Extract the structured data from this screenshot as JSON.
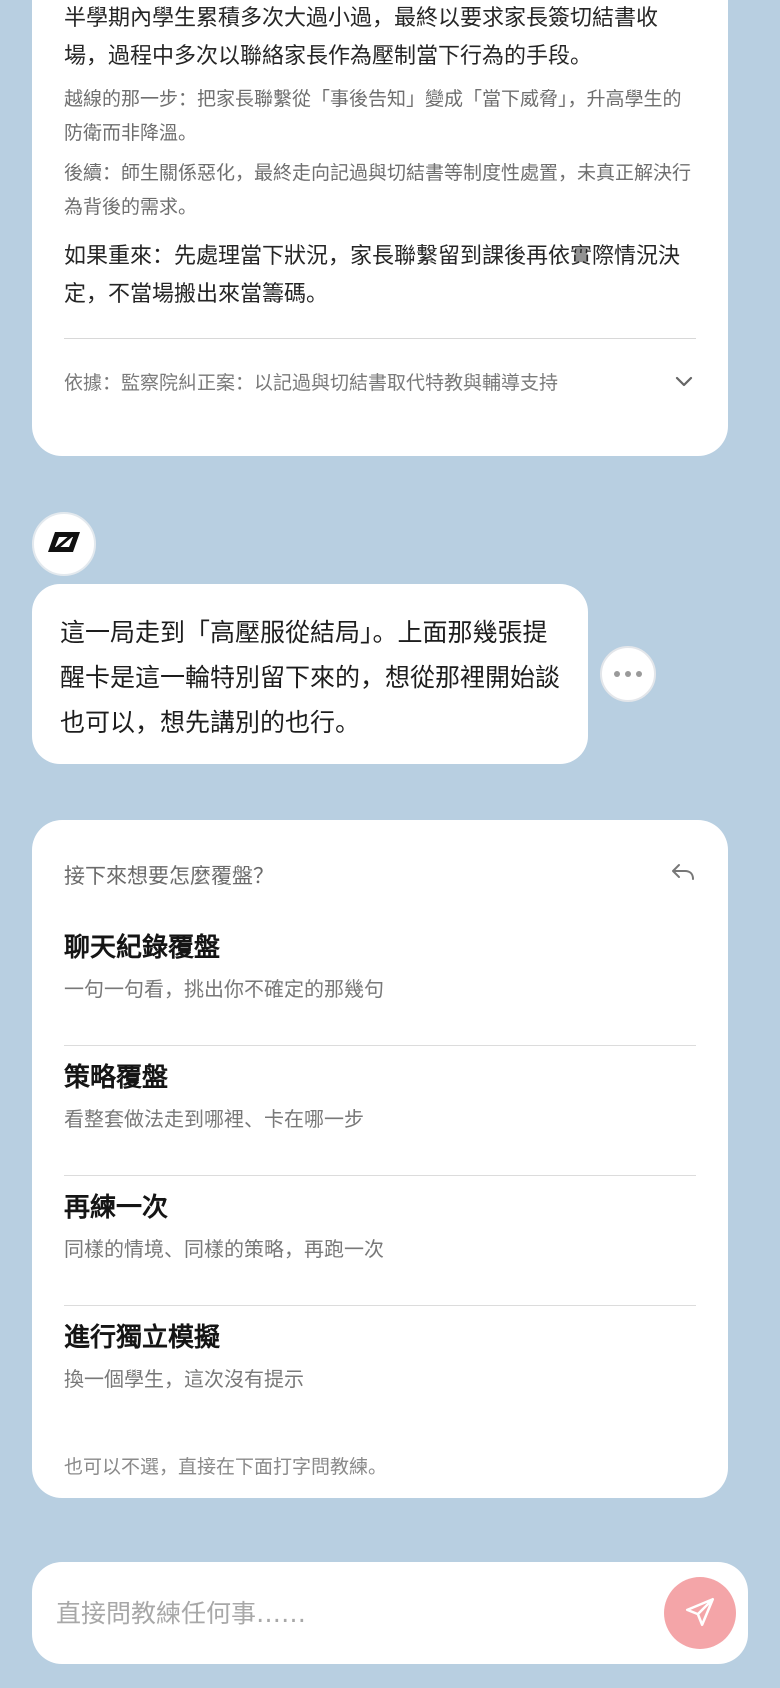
{
  "case_card": {
    "summary": "半學期內學生累積多次大過小過，最終以要求家長簽切結書收場，過程中多次以聯絡家長作為壓制當下行為的手段。",
    "crossing_line": "越線的那一步：把家長聯繫從「事後告知」變成「當下威脅」，升高學生的防衛而非降溫。",
    "follow_up": "後續：師生關係惡化，最終走向記過與切結書等制度性處置，未真正解決行為背後的需求。",
    "redo": "如果重來：先處理當下狀況，家長聯繫留到課後再依實際情況決定，不當場搬出來當籌碼。",
    "evidence": "依據：監察院糾正案：以記過與切結書取代特教與輔導支持"
  },
  "coach_message": "這一局走到「高壓服從結局」。上面那幾張提醒卡是這一輪特別留下來的，想從那裡開始談也可以，想先講別的也行。",
  "review": {
    "prompt": "接下來想要怎麼覆盤？",
    "options": [
      {
        "title": "聊天紀錄覆盤",
        "desc": "一句一句看，挑出你不確定的那幾句"
      },
      {
        "title": "策略覆盤",
        "desc": "看整套做法走到哪裡、卡在哪一步"
      },
      {
        "title": "再練一次",
        "desc": "同樣的情境、同樣的策略，再跑一次"
      },
      {
        "title": "進行獨立模擬",
        "desc": "換一個學生，這次沒有提示"
      }
    ],
    "hint": "也可以不選，直接在下面打字問教練。"
  },
  "input": {
    "placeholder": "直接問教練任何事……"
  },
  "icons": {
    "avatar": "coach-logo-icon",
    "more": "more-dots-icon",
    "back": "back-arrow-icon",
    "expand": "chevron-down-icon",
    "send": "send-icon"
  },
  "colors": {
    "background": "#b8cfe1",
    "card": "#ffffff",
    "send_button": "#f4a5a8"
  }
}
